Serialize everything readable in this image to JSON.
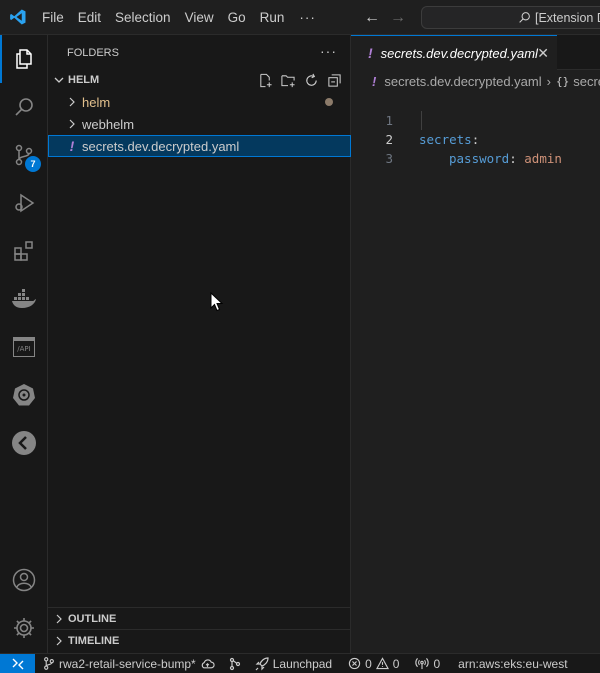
{
  "menu": {
    "items": [
      "File",
      "Edit",
      "Selection",
      "View",
      "Go",
      "Run"
    ],
    "more": "···"
  },
  "command_center": {
    "text": "[Extension D"
  },
  "activity_bar": {
    "items": [
      "explorer-icon",
      "search-icon",
      "source-control-icon",
      "run-debug-icon",
      "extensions-icon",
      "docker-icon",
      "api-icon",
      "kubernetes-icon",
      "pointer-icon"
    ],
    "source_control_badge": "7",
    "api_label": "/API",
    "bottom": [
      "account-icon",
      "manage-gear-icon"
    ]
  },
  "sidebar": {
    "title": "FOLDERS",
    "more": "···",
    "section": "HELM",
    "tree": [
      {
        "label": "helm",
        "type": "folder"
      },
      {
        "label": "webhelm",
        "type": "folder"
      },
      {
        "label": "secrets.dev.decrypted.yaml",
        "type": "file",
        "icon": "!"
      }
    ],
    "outline": "OUTLINE",
    "timeline": "TIMELINE"
  },
  "editor": {
    "tab": {
      "icon": "!",
      "label": "secrets.dev.decrypted.yaml",
      "close": "✕"
    },
    "breadcrumb": {
      "file": "secrets.dev.decrypted.yaml",
      "symbol_icon": "{}",
      "symbol": "secre"
    },
    "lines": [
      {
        "n": "1",
        "key": "secrets",
        "colon": ":",
        "val": ""
      },
      {
        "n": "2",
        "key": "password",
        "colon": ":",
        "val": "admin"
      },
      {
        "n": "3",
        "key": "",
        "colon": "",
        "val": ""
      }
    ]
  },
  "statusbar": {
    "branch": "rwa2-retail-service-bump*",
    "launchpad": "Launchpad",
    "errors": "0",
    "warnings": "0",
    "ports": "0",
    "context": "arn:aws:eks:eu-west"
  },
  "colors": {
    "accent": "#0078d4",
    "selection": "#04395e",
    "yaml_key": "#569cd6",
    "yaml_value": "#ce9178",
    "modified_folder": "#e2c08d",
    "warning_file_icon": "#b180d7"
  }
}
